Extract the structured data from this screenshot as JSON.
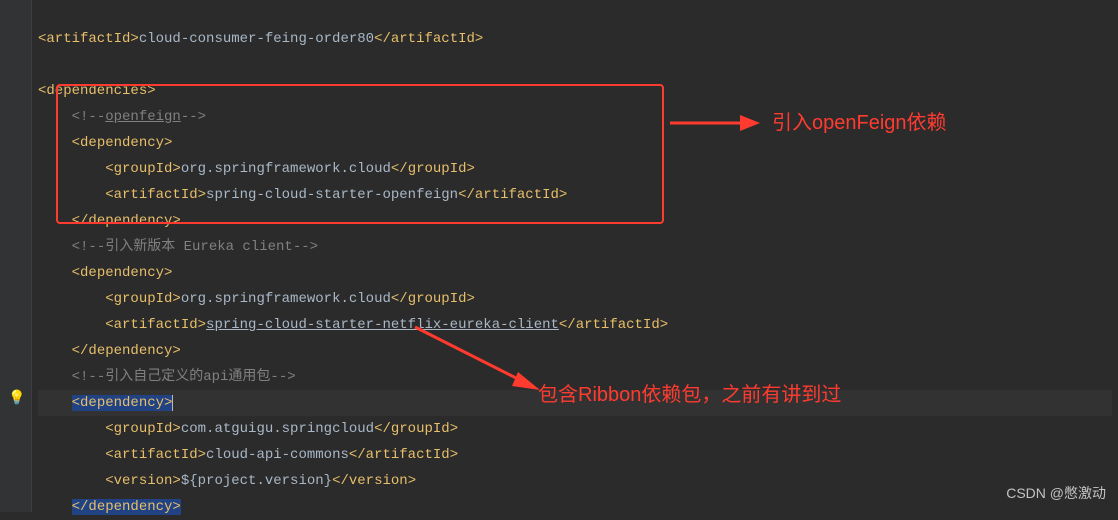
{
  "lines": {
    "l1_open": "<artifactId>",
    "l1_val": "cloud-consumer-feing-order80",
    "l1_close": "</artifactId>",
    "l3": "<dependencies>",
    "l4_c1": "<!--",
    "l4_c2": "openfeign",
    "l4_c3": "-->",
    "l5": "<dependency>",
    "l6_open": "<groupId>",
    "l6_val": "org.springframework.cloud",
    "l6_close": "</groupId>",
    "l7_open": "<artifactId>",
    "l7_val": "spring-cloud-starter-openfeign",
    "l7_close": "</artifactId>",
    "l8": "</dependency>",
    "l9_c": "<!--引入新版本 Eureka client-->",
    "l10": "<dependency>",
    "l11_open": "<groupId>",
    "l11_val": "org.springframework.cloud",
    "l11_close": "</groupId>",
    "l12_open": "<artifactId>",
    "l12_val": "spring-cloud-starter-netflix-eureka-client",
    "l12_close": "</artifactId>",
    "l13": "</dependency>",
    "l14_c": "<!--引入自己定义的api通用包-->",
    "l15": "<dependency>",
    "l16_open": "<groupId>",
    "l16_val": "com.atguigu.springcloud",
    "l16_close": "</groupId>",
    "l17_open": "<artifactId>",
    "l17_val": "cloud-api-commons",
    "l17_close": "</artifactId>",
    "l18_open": "<version>",
    "l18_val": "${project.version}",
    "l18_close": "</version>",
    "l19": "</dependency>"
  },
  "annotations": {
    "a1": "引入openFeign依赖",
    "a2": "包含Ribbon依赖包，之前有讲到过"
  },
  "watermark": "CSDN @憋激动",
  "bulb_icon": "💡"
}
